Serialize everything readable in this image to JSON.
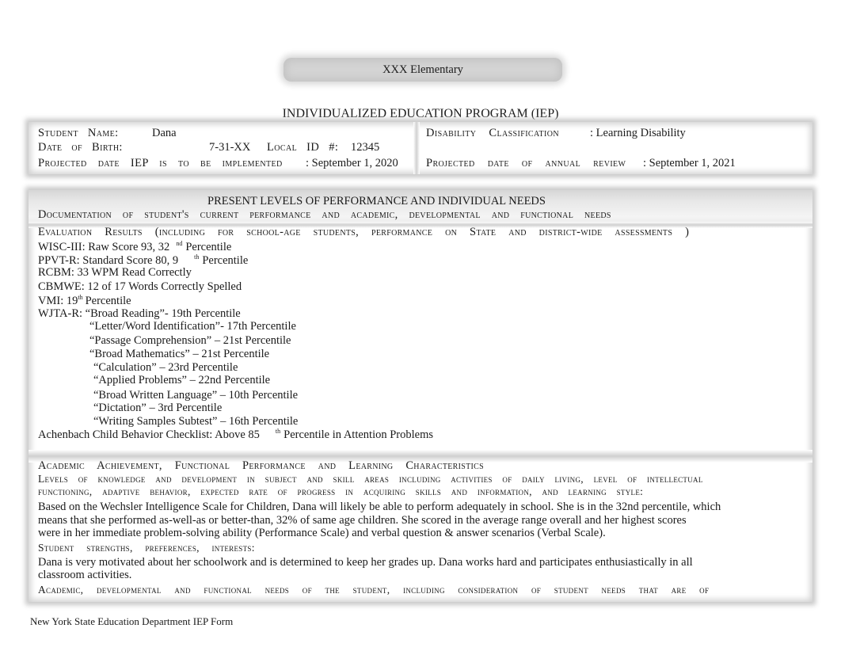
{
  "school_name": "XXX Elementary",
  "document_title": "INDIVIDUALIZED EDUCATION PROGRAM (IEP)",
  "student_info": {
    "student_name_label": "Student Name:",
    "student_name": "Dana",
    "dob_label": "Date of Birth:",
    "dob": "7-31-XX",
    "local_id_label": "Local ID #:",
    "local_id": "12345",
    "iep_implemented_label": "Projected date IEP is to be implemented",
    "iep_implemented_date": ": September 1, 2020",
    "disability_label": "Disability Classification",
    "disability": ":  Learning Disability",
    "annual_review_label": "Projected date of annual review",
    "annual_review_date": ": September 1, 2021"
  },
  "present_levels": {
    "heading": "PRESENT LEVELS OF PERFORMANCE AND INDIVIDUAL NEEDS",
    "documentation_label": "Documentation of student's current performance and academic, developmental and functional needs",
    "evaluation_label": "Evaluation Results (including for school-age students, performance on State and district-wide assessments )",
    "results": [
      {
        "text": "WISC-III: Raw Score 93, 32",
        "sup": "nd",
        "after": "Percentile"
      },
      {
        "text": "PPVT-R: Standard Score 80, 9",
        "sup": "th",
        "after": "Percentile"
      },
      {
        "text": "RCBM: 33 WPM Read Correctly"
      },
      {
        "text": "CBMWE: 12 of 17 Words Correctly Spelled"
      },
      {
        "text": "VMI: 19",
        "sup": "th",
        "after": "Percentile"
      },
      {
        "text": "WJTA-R: “Broad Reading”- 19th Percentile"
      },
      {
        "text": "“Letter/Word Identification”- 17th Percentile"
      },
      {
        "text": "“Passage Comprehension” – 21st Percentile"
      },
      {
        "text": "“Broad Mathematics” – 21st Percentile"
      },
      {
        "text": "“Calculation” – 23rd Percentile"
      },
      {
        "text": "“Applied Problems” – 22nd Percentile"
      },
      {
        "text": "“Broad Written Language” – 10th Percentile"
      },
      {
        "text": "“Dictation” – 3rd Percentile"
      },
      {
        "text": "“Writing Samples Subtest” – 16th Percentile"
      },
      {
        "text": "Achenbach Child Behavior Checklist: Above 85",
        "sup": "th",
        "after": "Percentile in Attention Problems"
      }
    ]
  },
  "academic_section": {
    "heading": "Academic Achievement, Functional Performance and Learning Characteristics",
    "levels_label_line1": "Levels of knowledge and development in subject and skill areas including activities of daily living, level of intellectual",
    "levels_label_line2": "functioning, adaptive behavior, expected rate of progress in acquiring skills and information, and learning style:",
    "levels_text": [
      "Based on the Wechsler Intelligence Scale for Children, Dana will likely be able to perform adequately in school. She is in the 32nd percentile, which",
      "means that she performed as-well-as or better-than, 32% of same age children. She scored in the average range overall and her highest scores",
      "were in her immediate problem-solving ability (Performance Scale) and verbal question & answer scenarios (Verbal Scale)."
    ],
    "strengths_label": "Student strengths, preferences, interests:",
    "strengths_text": [
      "Dana is very motivated about her schoolwork and is determined to keep her grades up. Dana works hard and participates enthusiastically in all",
      "classroom activities."
    ],
    "needs_label": "Academic, developmental and functional needs of the student, including consideration of student needs that are of"
  },
  "footer": "New York State Education Department IEP Form"
}
